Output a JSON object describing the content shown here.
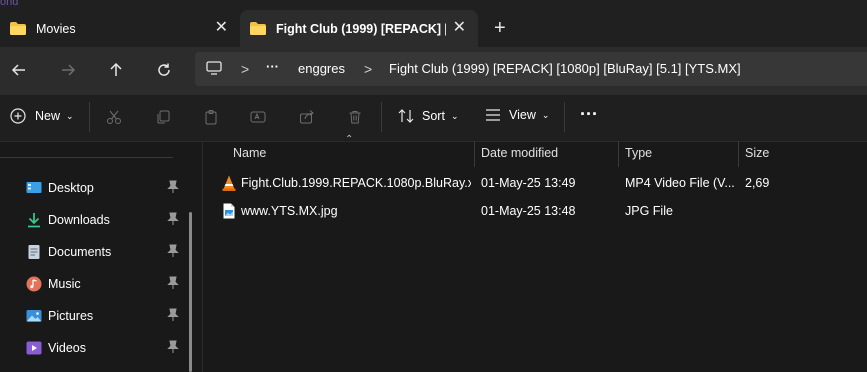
{
  "tabs": [
    {
      "label": "Movies",
      "icon": "folder-icon",
      "active": false
    },
    {
      "label": "Fight Club (1999) [REPACK] [1080p] [BluRay] [5.1] [YTS.MX]",
      "icon": "folder-icon",
      "active": true
    }
  ],
  "bleed_text": "ond",
  "nav": {
    "back_icon": "arrow-left-icon",
    "forward_icon": "arrow-right-icon",
    "up_icon": "arrow-up-icon",
    "refresh_icon": "refresh-icon"
  },
  "address": {
    "crumbs": [
      "enggres",
      "Fight Club (1999) [REPACK] [1080p] [BluRay] [5.1] [YTS.MX]"
    ],
    "overflow": "···"
  },
  "commands": {
    "new_label": "New",
    "sort_label": "Sort",
    "view_label": "View",
    "more_label": "···"
  },
  "sidebar": {
    "items": [
      {
        "label": "Desktop",
        "icon": "desktop-icon",
        "pinned": true
      },
      {
        "label": "Downloads",
        "icon": "download-icon",
        "pinned": true
      },
      {
        "label": "Documents",
        "icon": "document-icon",
        "pinned": true
      },
      {
        "label": "Music",
        "icon": "music-icon",
        "pinned": true
      },
      {
        "label": "Pictures",
        "icon": "pictures-icon",
        "pinned": true
      },
      {
        "label": "Videos",
        "icon": "videos-icon",
        "pinned": true
      }
    ]
  },
  "columns": [
    "Name",
    "Date modified",
    "Type",
    "Size"
  ],
  "files": [
    {
      "name": "Fight.Club.1999.REPACK.1080p.BluRay.x2...",
      "date": "01-May-25 13:49",
      "type": "MP4 Video File (V...",
      "size": "2,69",
      "icon": "vlc-icon"
    },
    {
      "name": "www.YTS.MX.jpg",
      "date": "01-May-25 13:48",
      "type": "JPG File",
      "size": "",
      "icon": "image-file-icon"
    }
  ],
  "colors": {
    "folder": "#f3c244",
    "vlc": "#f08a24",
    "accent": "#4cc2ff"
  }
}
